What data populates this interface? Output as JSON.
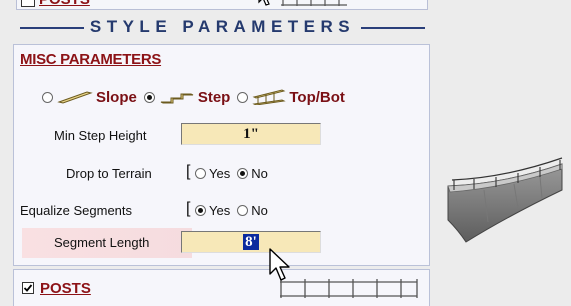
{
  "header": {
    "posts_top_label": "POSTS",
    "title": "STYLE PARAMETERS"
  },
  "misc": {
    "heading": "MISC PARAMETERS",
    "modes": [
      {
        "label": "Slope",
        "selected": false
      },
      {
        "label": "Step",
        "selected": true
      },
      {
        "label": "Top/Bot",
        "selected": false
      }
    ],
    "min_step_height": {
      "label": "Min Step Height",
      "value": "1\""
    },
    "drop_to_terrain": {
      "label": "Drop to Terrain",
      "yes": "Yes",
      "no": "No",
      "selected": "No"
    },
    "equalize_segments": {
      "label": "Equalize Segments",
      "yes": "Yes",
      "no": "No",
      "selected": "Yes"
    },
    "segment_length": {
      "label": "Segment Length",
      "value": "8'"
    }
  },
  "posts": {
    "label": "POSTS",
    "checked": true
  },
  "colors": {
    "accent_red": "#8c1216",
    "title_blue": "#253a6e",
    "input_bg": "#f7e8b8",
    "selection": "#0b2a9e"
  }
}
